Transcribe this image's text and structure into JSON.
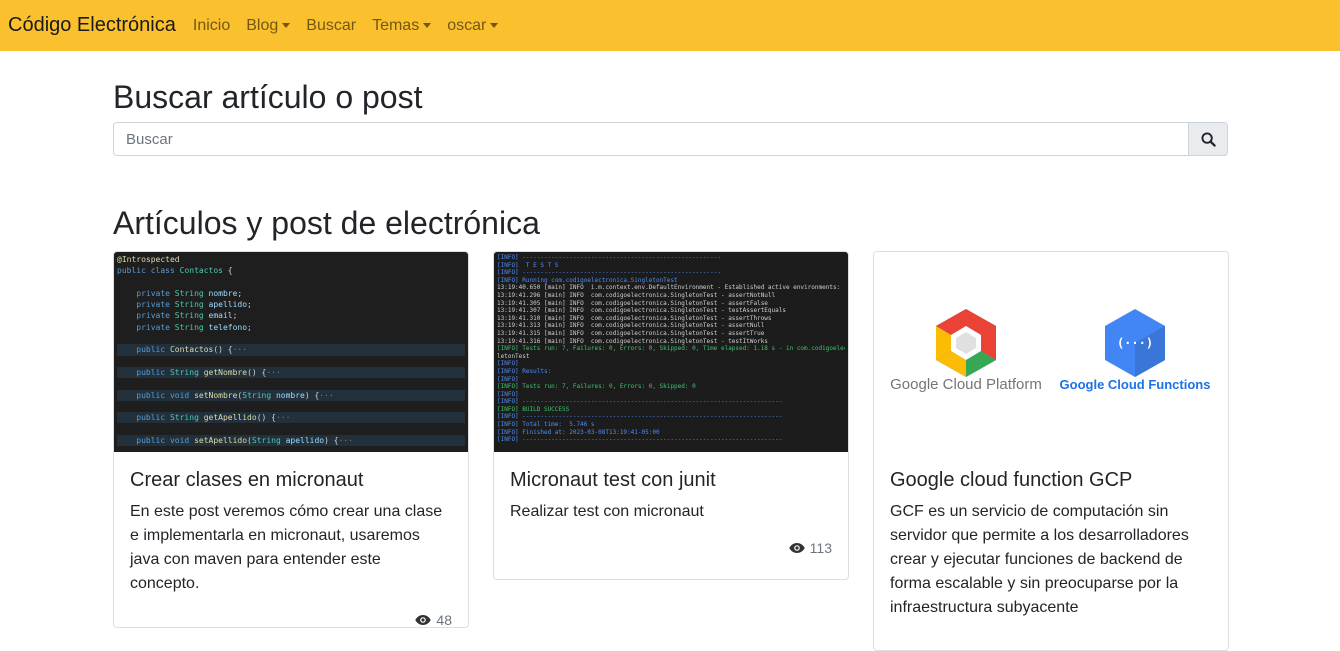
{
  "navbar": {
    "brand": "Código Electrónica",
    "items": [
      {
        "label": "Inicio",
        "dropdown": false
      },
      {
        "label": "Blog",
        "dropdown": true
      },
      {
        "label": "Buscar",
        "dropdown": false
      },
      {
        "label": "Temas",
        "dropdown": true
      },
      {
        "label": "oscar",
        "dropdown": true
      }
    ],
    "background": "#fbc02d"
  },
  "search": {
    "title": "Buscar artículo o post",
    "placeholder": "Buscar",
    "button_icon": "search-icon"
  },
  "section": {
    "title": "Artículos y post de electrónica"
  },
  "cards": [
    {
      "title": "Crear clases en micronaut",
      "text": "En este post veremos cómo crear una clase e implementarla en micronaut, usaremos java con maven para entender este concepto.",
      "views": "48",
      "image": {
        "type": "code",
        "lines": [
          "@Introspected",
          "public class Contactos {",
          "",
          "    private String nombre;",
          "    private String apellido;",
          "    private String email;",
          "    private String telefono;",
          "",
          "    public Contactos() {···",
          "",
          "    public String getNombre() {···",
          "",
          "    public void setNombre(String nombre) {···",
          "",
          "    public String getApellido() {···",
          "",
          "    public void setApellido(String apellido) {···"
        ]
      }
    },
    {
      "title": "Micronaut test con junit",
      "text": "Realizar test con micronaut",
      "views": "113",
      "image": {
        "type": "terminal",
        "lines": [
          "[INFO] -------------------------------------------------------",
          "[INFO]  T E S T S",
          "[INFO] -------------------------------------------------------",
          "[INFO] Running com.codigoelectronica.SingletonTest",
          "13:19:40.650 [main] INFO  i.m.context.env.DefaultEnvironment - Established active environments: [test]",
          "13:19:41.296 [main] INFO  com.codigoelectronica.SingletonTest - assertNotNull",
          "13:19:41.305 [main] INFO  com.codigoelectronica.SingletonTest - assertFalse",
          "13:19:41.307 [main] INFO  com.codigoelectronica.SingletonTest - testAssertEquals",
          "13:19:41.310 [main] INFO  com.codigoelectronica.SingletonTest - assertThrows",
          "13:19:41.313 [main] INFO  com.codigoelectronica.SingletonTest - assertNull",
          "13:19:41.315 [main] INFO  com.codigoelectronica.SingletonTest - assertTrue",
          "13:19:41.316 [main] INFO  com.codigoelectronica.SingletonTest - testItWorks",
          "[INFO] Tests run: 7, Failures: 0, Errors: 0, Skipped: 0, Time elapsed: 1.18 s - in com.codigoelectronica.Sing",
          "letonTest",
          "[INFO]",
          "[INFO] Results:",
          "[INFO]",
          "[INFO] Tests run: 7, Failures: 0, Errors: 0, Skipped: 0",
          "[INFO]",
          "[INFO] ------------------------------------------------------------------------",
          "[INFO] BUILD SUCCESS",
          "[INFO] ------------------------------------------------------------------------",
          "[INFO] Total time:  5.746 s",
          "[INFO] Finished at: 2023-03-08T13:19:41-05:00",
          "[INFO] ------------------------------------------------------------------------"
        ]
      }
    },
    {
      "title": "Google cloud function GCP",
      "text": "GCF es un servicio de computación sin servidor que permite a los desarrolladores crear y ejecutar funciones de backend de forma escalable y sin preocuparse por la infraestructura subyacente",
      "image": {
        "type": "logos",
        "left_caption": "Google Cloud Platform",
        "right_caption": "Google Cloud Functions",
        "functions_symbol": "(···)"
      }
    }
  ]
}
